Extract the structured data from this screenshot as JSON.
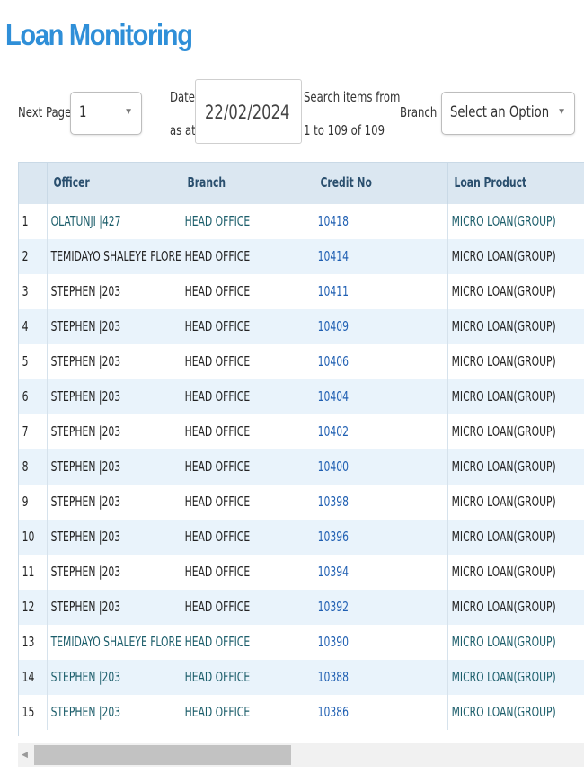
{
  "page": {
    "title": "Loan Monitoring"
  },
  "toolbar": {
    "next_page_label": "Next Page",
    "next_page_value": "1",
    "date_label_line1": "Date",
    "date_label_line2": "as at",
    "date_value": "22/02/2024",
    "search_info_line1": "Search items from",
    "search_info_line2": "1 to 109 of 109",
    "branch_label": "Branch",
    "branch_value": "Select an Option"
  },
  "table": {
    "columns": [
      "",
      "Officer",
      "Branch",
      "Credit No",
      "Loan Product"
    ],
    "rows": [
      {
        "n": "1",
        "officer": "OLATUNJI |427",
        "branch": "HEAD OFFICE",
        "credit": "10418",
        "product": "MICRO LOAN(GROUP)"
      },
      {
        "n": "2",
        "officer": "TEMIDAYO SHALEYE FLORENCE",
        "branch": "HEAD OFFICE",
        "credit": "10414",
        "product": "MICRO LOAN(GROUP)"
      },
      {
        "n": "3",
        "officer": "STEPHEN |203",
        "branch": "HEAD OFFICE",
        "credit": "10411",
        "product": "MICRO LOAN(GROUP)"
      },
      {
        "n": "4",
        "officer": "STEPHEN |203",
        "branch": "HEAD OFFICE",
        "credit": "10409",
        "product": "MICRO LOAN(GROUP)"
      },
      {
        "n": "5",
        "officer": "STEPHEN |203",
        "branch": "HEAD OFFICE",
        "credit": "10406",
        "product": "MICRO LOAN(GROUP)"
      },
      {
        "n": "6",
        "officer": "STEPHEN |203",
        "branch": "HEAD OFFICE",
        "credit": "10404",
        "product": "MICRO LOAN(GROUP)"
      },
      {
        "n": "7",
        "officer": "STEPHEN |203",
        "branch": "HEAD OFFICE",
        "credit": "10402",
        "product": "MICRO LOAN(GROUP)"
      },
      {
        "n": "8",
        "officer": "STEPHEN |203",
        "branch": "HEAD OFFICE",
        "credit": "10400",
        "product": "MICRO LOAN(GROUP)"
      },
      {
        "n": "9",
        "officer": "STEPHEN |203",
        "branch": "HEAD OFFICE",
        "credit": "10398",
        "product": "MICRO LOAN(GROUP)"
      },
      {
        "n": "10",
        "officer": "STEPHEN |203",
        "branch": "HEAD OFFICE",
        "credit": "10396",
        "product": "MICRO LOAN(GROUP)"
      },
      {
        "n": "11",
        "officer": "STEPHEN |203",
        "branch": "HEAD OFFICE",
        "credit": "10394",
        "product": "MICRO LOAN(GROUP)"
      },
      {
        "n": "12",
        "officer": "STEPHEN |203",
        "branch": "HEAD OFFICE",
        "credit": "10392",
        "product": "MICRO LOAN(GROUP)"
      },
      {
        "n": "13",
        "officer": "TEMIDAYO SHALEYE FLORENCE",
        "branch": "HEAD OFFICE",
        "credit": "10390",
        "product": "MICRO LOAN(GROUP)"
      },
      {
        "n": "14",
        "officer": "STEPHEN |203",
        "branch": "HEAD OFFICE",
        "credit": "10388",
        "product": "MICRO LOAN(GROUP)"
      },
      {
        "n": "15",
        "officer": "STEPHEN |203",
        "branch": "HEAD OFFICE",
        "credit": "10386",
        "product": "MICRO LOAN(GROUP)"
      }
    ]
  },
  "icons": {
    "next_page_caret": "chevron-down-icon",
    "branch_caret": "chevron-down-icon",
    "scroll_left": "arrow-left-icon"
  },
  "colors": {
    "title": "#2f8fd8",
    "header_bg": "#dbe7f1",
    "row_alt_bg": "#e9f3fb",
    "link": "#1f5fb2"
  }
}
